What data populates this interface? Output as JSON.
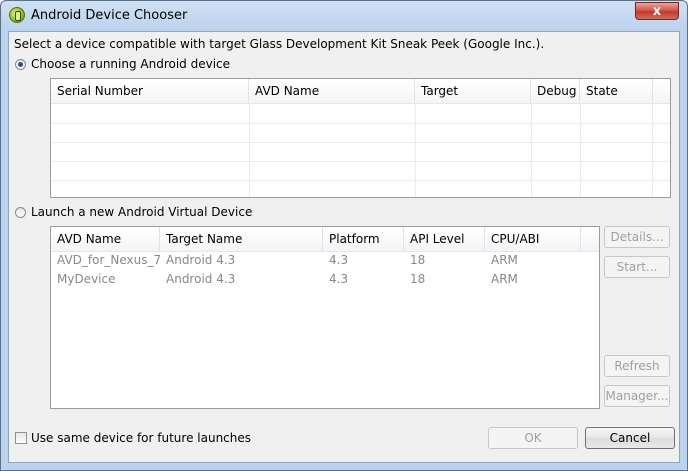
{
  "window": {
    "title": "Android Device Chooser",
    "close_glyph": "x"
  },
  "intro": "Select a device compatible with target Glass Development Kit Sneak Peek (Google Inc.).",
  "running": {
    "radio_label": "Choose a running Android device",
    "columns": [
      "Serial Number",
      "AVD Name",
      "Target",
      "Debug",
      "State"
    ]
  },
  "avd": {
    "radio_label": "Launch a new Android Virtual Device",
    "columns": [
      "AVD Name",
      "Target Name",
      "Platform",
      "API Level",
      "CPU/ABI"
    ],
    "rows": [
      {
        "name": "AVD_for_Nexus_7",
        "target": "Android 4.3",
        "platform": "4.3",
        "api": "18",
        "abi": "ARM (armeabi-..."
      },
      {
        "name": "MyDevice",
        "target": "Android 4.3",
        "platform": "4.3",
        "api": "18",
        "abi": "ARM (armeabi-..."
      }
    ],
    "buttons": {
      "details": "Details...",
      "start": "Start...",
      "refresh": "Refresh",
      "manager": "Manager..."
    }
  },
  "footer": {
    "checkbox_label": "Use same device for future launches",
    "ok": "OK",
    "cancel": "Cancel"
  }
}
